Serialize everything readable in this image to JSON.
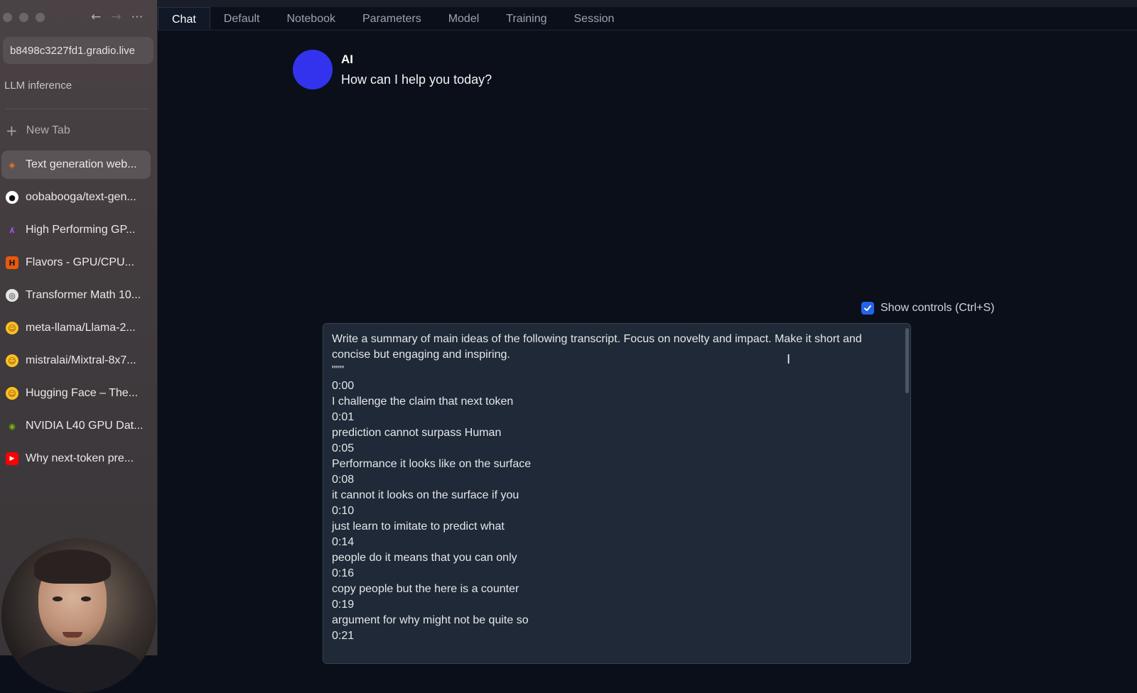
{
  "browser": {
    "url_prefix": "b",
    "url": "b8498c3227fd1.gradio.live",
    "space_label": "LLM inference",
    "new_tab_label": "New Tab",
    "tabs": [
      {
        "label": "Text generation web...",
        "icon": "gradio-icon",
        "color": "#f97316",
        "active": true
      },
      {
        "label": "oobabooga/text-gen...",
        "icon": "github-icon",
        "color": "#ffffff"
      },
      {
        "label": "High Performing GP...",
        "icon": "lambda-icon",
        "color": "#a855f7"
      },
      {
        "label": "Flavors - GPU/CPU...",
        "icon": "h-icon",
        "color": "#ea580c"
      },
      {
        "label": "Transformer Math 10...",
        "icon": "eleuther-icon",
        "color": "#e5e5e5"
      },
      {
        "label": "meta-llama/Llama-2...",
        "icon": "hugging-face-icon",
        "color": "#fbbf24"
      },
      {
        "label": "mistralai/Mixtral-8x7...",
        "icon": "hugging-face-icon",
        "color": "#fbbf24"
      },
      {
        "label": "Hugging Face – The...",
        "icon": "hugging-face-icon",
        "color": "#fbbf24"
      },
      {
        "label": "NVIDIA L40 GPU Dat...",
        "icon": "nvidia-icon",
        "color": "#76b900"
      },
      {
        "label": "Why next-token pre...",
        "icon": "youtube-icon",
        "color": "#ff0000"
      }
    ]
  },
  "app": {
    "tabs": [
      "Chat",
      "Default",
      "Notebook",
      "Parameters",
      "Model",
      "Training",
      "Session"
    ],
    "active_tab": "Chat",
    "ai_name": "AI",
    "ai_message": "How can I help you today?",
    "show_controls_label": "Show controls (Ctrl+S)",
    "show_controls_checked": true,
    "prompt_lines": [
      "Write a summary of main ideas of the following transcript. Focus on novelty and impact. Make it short and concise but engaging and inspiring.",
      "\"\"\"",
      "0:00",
      "I challenge the claim that next token",
      "0:01",
      "prediction cannot surpass Human",
      "0:05",
      "Performance it looks like on the surface",
      "0:08",
      "it cannot it looks on the surface if you",
      "0:10",
      "just learn to imitate to predict what",
      "0:14",
      "people do it means that you can only",
      "0:16",
      "copy people but the here is a counter",
      "0:19",
      "argument for why might not be quite so",
      "0:21"
    ]
  },
  "colors": {
    "accent": "#2563eb",
    "avatar": "#3333ee",
    "background": "#0b0f19",
    "input_bg": "#1f2937"
  }
}
